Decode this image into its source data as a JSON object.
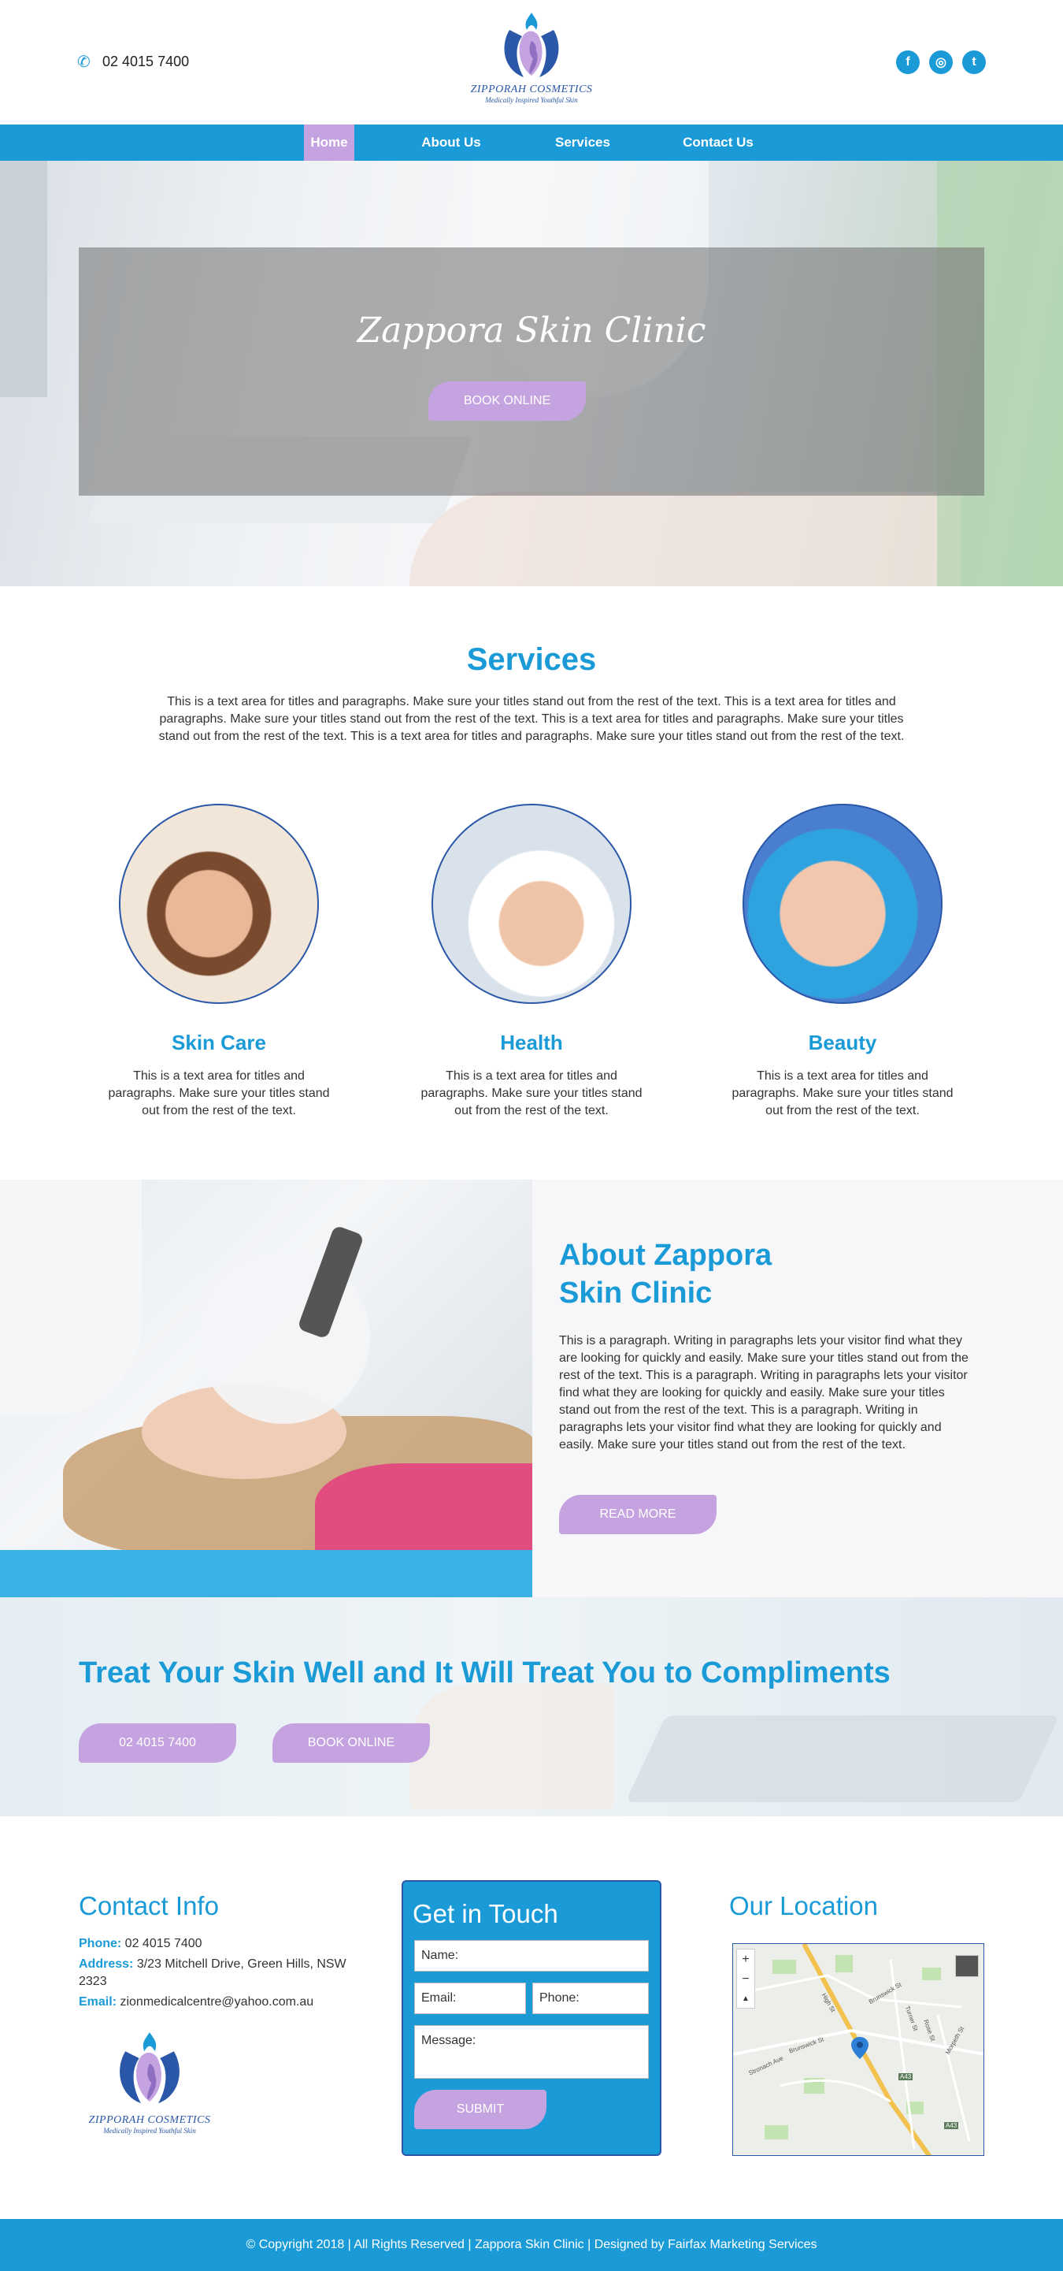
{
  "colors": {
    "accent": "#1a9ad6",
    "lavender": "#c5a3e0",
    "logo_blue": "#2a57a8"
  },
  "header": {
    "phone": "02 4015 7400",
    "phone_icon": "phone-icon",
    "logo_name": "ZIPPORAH COSMETICS",
    "logo_tagline": "Medically Inspired Youthful Skin",
    "socials": [
      {
        "icon": "facebook-icon",
        "glyph": "f"
      },
      {
        "icon": "instagram-icon",
        "glyph": "◎"
      },
      {
        "icon": "twitter-icon",
        "glyph": "t"
      }
    ]
  },
  "nav": {
    "items": [
      "Home",
      "About Us",
      "Services",
      "Contact Us"
    ],
    "active": "Home"
  },
  "hero": {
    "title": "Zappora Skin Clinic",
    "button": "BOOK ONLINE"
  },
  "services": {
    "title": "Services",
    "intro": "This is a text area for titles and paragraphs. Make sure your titles stand out from the rest of the text. This is a text area for titles and paragraphs. Make sure your titles stand out from the rest of the text. This is a text area for titles and paragraphs. Make sure your titles stand out from the rest of the text. This is a text area for titles and paragraphs. Make sure your titles stand out from the rest of the text.",
    "items": [
      {
        "title": "Skin Care",
        "text": "This is a text area for titles and paragraphs. Make sure your titles stand out from the rest of the text."
      },
      {
        "title": "Health",
        "text": "This is a text area for titles and paragraphs. Make sure your titles stand out from the rest of the text."
      },
      {
        "title": "Beauty",
        "text": "This is a text area for titles and paragraphs. Make sure your titles stand out from the rest of the text."
      }
    ]
  },
  "about": {
    "title_line1": "About Zappora",
    "title_line2": "Skin Clinic",
    "text": "This is a paragraph. Writing in paragraphs lets your visitor find what they are looking for quickly and easily. Make sure your titles stand out from the rest of the text. This is a paragraph. Writing in paragraphs lets your visitor find what they are looking for quickly and easily. Make sure your titles stand out from the rest of the text. This is a paragraph. Writing in paragraphs lets your visitor find what they are looking for quickly and easily. Make sure your titles stand out from the rest of the text.",
    "button": "READ MORE"
  },
  "banner": {
    "title": "Treat Your Skin Well and It Will Treat You to Compliments",
    "phone_button": "02 4015 7400",
    "book_button": "BOOK ONLINE"
  },
  "contact": {
    "title": "Contact Info",
    "phone_label": "Phone:",
    "phone": "02 4015 7400",
    "address_label": "Address:",
    "address": "3/23 Mitchell Drive, Green Hills, NSW 2323",
    "email_label": "Email:",
    "email": "zionmedicalcentre@yahoo.com.au"
  },
  "form": {
    "title": "Get in Touch",
    "name_placeholder": "Name:",
    "email_placeholder": "Email:",
    "phone_placeholder": "Phone:",
    "message_placeholder": "Message:",
    "submit": "SUBMIT"
  },
  "location": {
    "title": "Our Location",
    "zoom_in": "+",
    "zoom_out": "−",
    "compass": "▲",
    "street_labels": [
      "Brunswick St",
      "Hooper St",
      "High St",
      "Morpeth St",
      "Turner St",
      "Stronach Ave",
      "Rose St"
    ],
    "road_badges": [
      "A43",
      "A43"
    ]
  },
  "footer": {
    "text": "© Copyright 2018 | All Rights Reserved | Zappora Skin Clinic | Designed by Fairfax Marketing Services"
  }
}
